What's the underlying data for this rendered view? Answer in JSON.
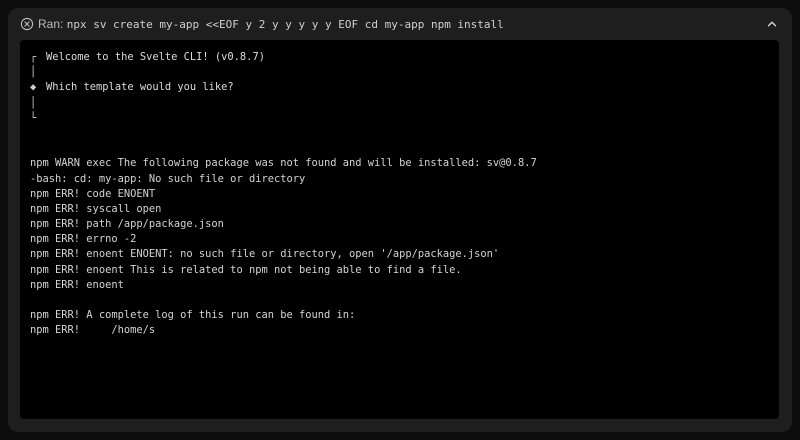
{
  "header": {
    "ran_label": "Ran:",
    "command": "npx sv create my-app <<EOF y 2 y y y y y EOF cd my-app npm install",
    "status_icon": "circle-x-icon",
    "collapse_icon": "chevron-up-icon"
  },
  "terminal": {
    "lines": [
      {
        "glyph": "┌",
        "text": "Welcome to the Svelte CLI! (v0.8.7)"
      },
      {
        "glyph": "│",
        "text": ""
      },
      {
        "glyph": "◆",
        "text": "Which template would you like?"
      },
      {
        "glyph": "│",
        "text": ""
      },
      {
        "glyph": "└",
        "text": ""
      },
      {
        "glyph": "",
        "text": ""
      },
      {
        "glyph": "",
        "text": ""
      },
      {
        "glyph": "",
        "text": "npm WARN exec The following package was not found and will be installed: sv@0.8.7"
      },
      {
        "glyph": "",
        "text": "-bash: cd: my-app: No such file or directory"
      },
      {
        "glyph": "",
        "text": "npm ERR! code ENOENT"
      },
      {
        "glyph": "",
        "text": "npm ERR! syscall open"
      },
      {
        "glyph": "",
        "text": "npm ERR! path /app/package.json"
      },
      {
        "glyph": "",
        "text": "npm ERR! errno -2"
      },
      {
        "glyph": "",
        "text": "npm ERR! enoent ENOENT: no such file or directory, open '/app/package.json'"
      },
      {
        "glyph": "",
        "text": "npm ERR! enoent This is related to npm not being able to find a file."
      },
      {
        "glyph": "",
        "text": "npm ERR! enoent"
      },
      {
        "glyph": "",
        "text": ""
      },
      {
        "glyph": "",
        "text": "npm ERR! A complete log of this run can be found in:"
      },
      {
        "glyph": "",
        "text": "npm ERR!     /home/s"
      }
    ]
  },
  "colors": {
    "page_bg": "#0c0c0c",
    "panel_bg": "#1e1e1e",
    "terminal_bg": "#000000",
    "text": "#d4d4d4"
  }
}
